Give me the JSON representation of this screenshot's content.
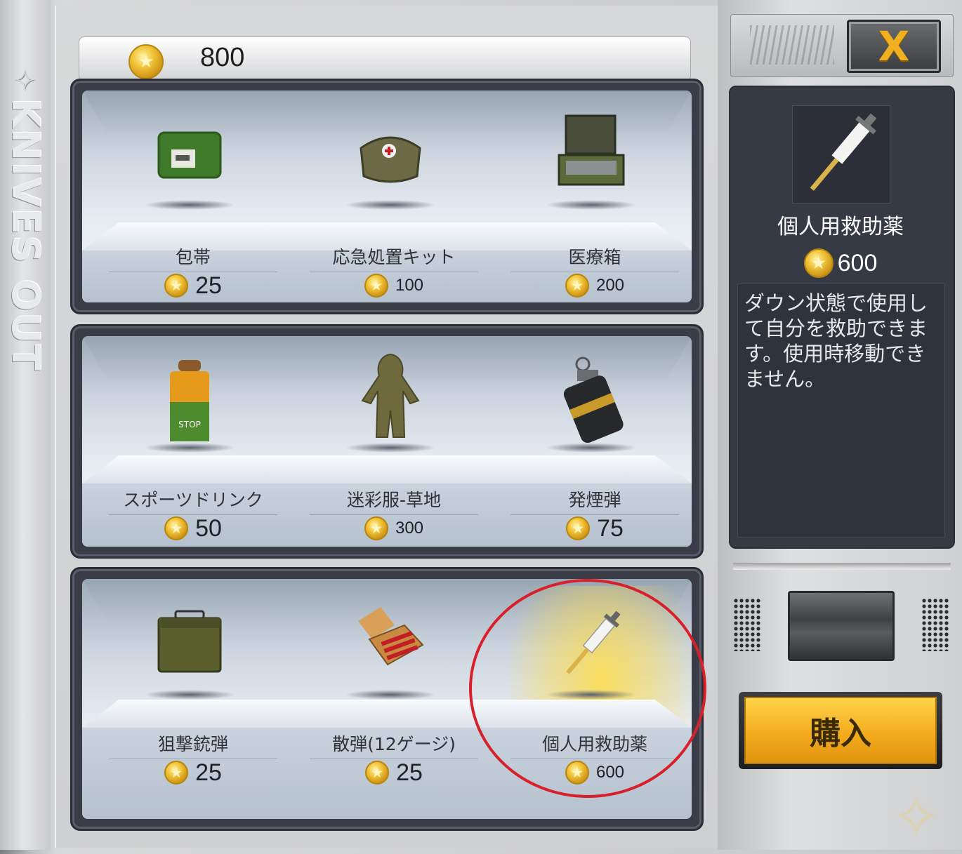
{
  "brand": {
    "name": "KNIVES OUT"
  },
  "balance": {
    "value": "800"
  },
  "shelves": [
    {
      "items": [
        {
          "name": "包帯",
          "price": "25",
          "icon": "bandage-icon"
        },
        {
          "name": "応急処置キット",
          "price": "100",
          "icon": "first-aid-kit-icon"
        },
        {
          "name": "医療箱",
          "price": "200",
          "icon": "medical-box-icon"
        }
      ]
    },
    {
      "items": [
        {
          "name": "スポーツドリンク",
          "price": "50",
          "icon": "sports-drink-icon"
        },
        {
          "name": "迷彩服-草地",
          "price": "300",
          "icon": "ghillie-suit-icon"
        },
        {
          "name": "発煙弾",
          "price": "75",
          "icon": "smoke-grenade-icon"
        }
      ]
    },
    {
      "items": [
        {
          "name": "狙撃銃弾",
          "price": "25",
          "icon": "ammo-box-icon"
        },
        {
          "name": "散弾(12ゲージ)",
          "price": "25",
          "icon": "shotgun-shells-icon"
        },
        {
          "name": "個人用救助薬",
          "price": "600",
          "icon": "syringe-icon",
          "selected": true
        }
      ]
    }
  ],
  "detail": {
    "name": "個人用救助薬",
    "price": "600",
    "description": "ダウン状態で使用して自分を救助できます。使用時移動できません。",
    "icon": "syringe-icon"
  },
  "buttons": {
    "buy_label": "購入",
    "close_label": "X"
  },
  "colors": {
    "accent": "#f2a91a",
    "annotation": "#d8202b",
    "panel": "#363a44"
  }
}
